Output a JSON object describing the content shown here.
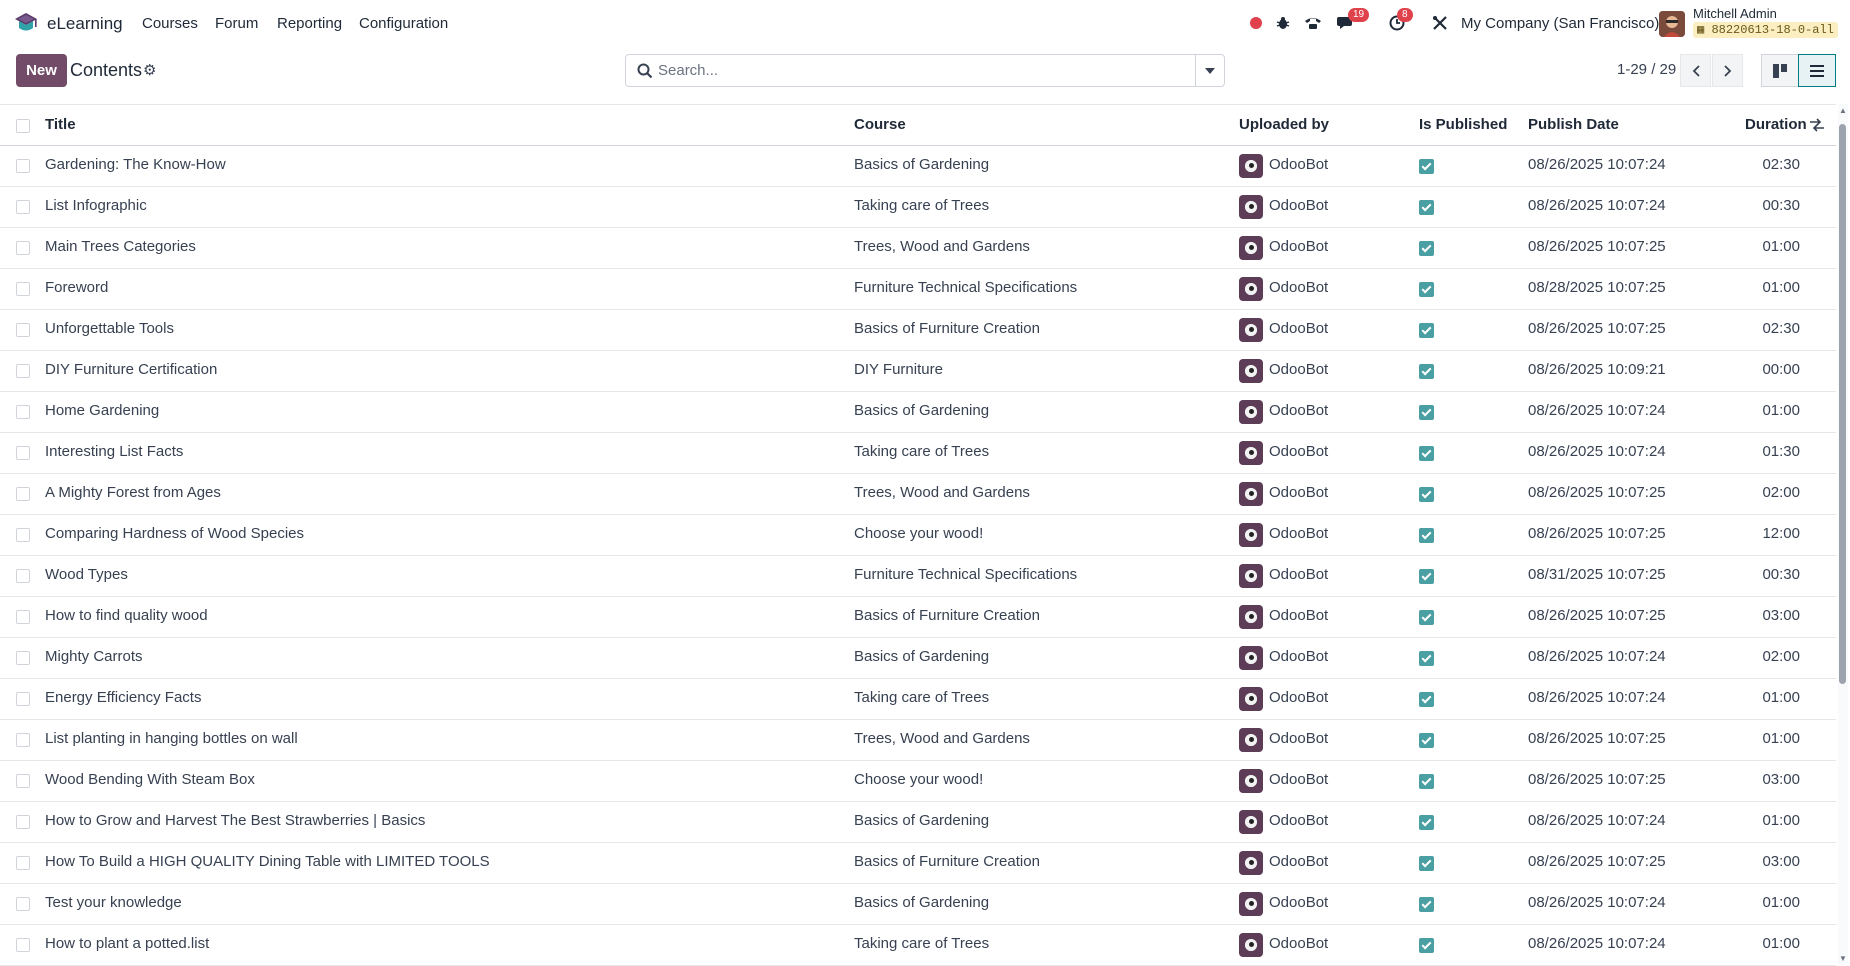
{
  "app": {
    "name": "eLearning",
    "menus": [
      "Courses",
      "Forum",
      "Reporting",
      "Configuration"
    ],
    "company": "My Company (San Francisco)",
    "user_name": "Mitchell Admin",
    "db_badge": "88220613-18-0-all",
    "badges": {
      "messages": "19",
      "activities": "8"
    }
  },
  "control": {
    "new_label": "New",
    "breadcrumb": "Contents",
    "search_placeholder": "Search...",
    "pager": "1-29 / 29"
  },
  "table": {
    "columns": [
      "Title",
      "Course",
      "Uploaded by",
      "Is Published",
      "Publish Date",
      "Duration"
    ],
    "rows": [
      {
        "title": "Gardening: The Know-How",
        "course": "Basics of Gardening",
        "uploader": "OdooBot",
        "published": true,
        "date": "08/26/2025 10:07:24",
        "duration": "02:30"
      },
      {
        "title": "List Infographic",
        "course": "Taking care of Trees",
        "uploader": "OdooBot",
        "published": true,
        "date": "08/26/2025 10:07:24",
        "duration": "00:30"
      },
      {
        "title": "Main Trees Categories",
        "course": "Trees, Wood and Gardens",
        "uploader": "OdooBot",
        "published": true,
        "date": "08/26/2025 10:07:25",
        "duration": "01:00"
      },
      {
        "title": "Foreword",
        "course": "Furniture Technical Specifications",
        "uploader": "OdooBot",
        "published": true,
        "date": "08/28/2025 10:07:25",
        "duration": "01:00"
      },
      {
        "title": "Unforgettable Tools",
        "course": "Basics of Furniture Creation",
        "uploader": "OdooBot",
        "published": true,
        "date": "08/26/2025 10:07:25",
        "duration": "02:30"
      },
      {
        "title": "DIY Furniture Certification",
        "course": "DIY Furniture",
        "uploader": "OdooBot",
        "published": true,
        "date": "08/26/2025 10:09:21",
        "duration": "00:00"
      },
      {
        "title": "Home Gardening",
        "course": "Basics of Gardening",
        "uploader": "OdooBot",
        "published": true,
        "date": "08/26/2025 10:07:24",
        "duration": "01:00"
      },
      {
        "title": "Interesting List Facts",
        "course": "Taking care of Trees",
        "uploader": "OdooBot",
        "published": true,
        "date": "08/26/2025 10:07:24",
        "duration": "01:30"
      },
      {
        "title": "A Mighty Forest from Ages",
        "course": "Trees, Wood and Gardens",
        "uploader": "OdooBot",
        "published": true,
        "date": "08/26/2025 10:07:25",
        "duration": "02:00"
      },
      {
        "title": "Comparing Hardness of Wood Species",
        "course": "Choose your wood!",
        "uploader": "OdooBot",
        "published": true,
        "date": "08/26/2025 10:07:25",
        "duration": "12:00"
      },
      {
        "title": "Wood Types",
        "course": "Furniture Technical Specifications",
        "uploader": "OdooBot",
        "published": true,
        "date": "08/31/2025 10:07:25",
        "duration": "00:30"
      },
      {
        "title": "How to find quality wood",
        "course": "Basics of Furniture Creation",
        "uploader": "OdooBot",
        "published": true,
        "date": "08/26/2025 10:07:25",
        "duration": "03:00"
      },
      {
        "title": "Mighty Carrots",
        "course": "Basics of Gardening",
        "uploader": "OdooBot",
        "published": true,
        "date": "08/26/2025 10:07:24",
        "duration": "02:00"
      },
      {
        "title": "Energy Efficiency Facts",
        "course": "Taking care of Trees",
        "uploader": "OdooBot",
        "published": true,
        "date": "08/26/2025 10:07:24",
        "duration": "01:00"
      },
      {
        "title": "List planting in hanging bottles on wall",
        "course": "Trees, Wood and Gardens",
        "uploader": "OdooBot",
        "published": true,
        "date": "08/26/2025 10:07:25",
        "duration": "01:00"
      },
      {
        "title": "Wood Bending With Steam Box",
        "course": "Choose your wood!",
        "uploader": "OdooBot",
        "published": true,
        "date": "08/26/2025 10:07:25",
        "duration": "03:00"
      },
      {
        "title": "How to Grow and Harvest The Best Strawberries | Basics",
        "course": "Basics of Gardening",
        "uploader": "OdooBot",
        "published": true,
        "date": "08/26/2025 10:07:24",
        "duration": "01:00"
      },
      {
        "title": "How To Build a HIGH QUALITY Dining Table with LIMITED TOOLS",
        "course": "Basics of Furniture Creation",
        "uploader": "OdooBot",
        "published": true,
        "date": "08/26/2025 10:07:25",
        "duration": "03:00"
      },
      {
        "title": "Test your knowledge",
        "course": "Basics of Gardening",
        "uploader": "OdooBot",
        "published": true,
        "date": "08/26/2025 10:07:24",
        "duration": "01:00"
      },
      {
        "title": "How to plant a potted.list",
        "course": "Taking care of Trees",
        "uploader": "OdooBot",
        "published": true,
        "date": "08/26/2025 10:07:24",
        "duration": "01:00"
      }
    ]
  },
  "colors": {
    "brand": "#714b67",
    "accent": "#017e84",
    "published_check": "#4a9fa3",
    "badge": "#e0424b",
    "record_dot": "#e0424b"
  },
  "icons": [
    "app-logo-icon",
    "record-icon",
    "bug-icon",
    "phone-icon",
    "messages-icon",
    "activity-clock-icon",
    "tools-icon",
    "gear-icon",
    "search-icon",
    "caret-down-icon",
    "chevron-left-icon",
    "chevron-right-icon",
    "kanban-view-icon",
    "list-view-icon",
    "optional-columns-icon"
  ]
}
